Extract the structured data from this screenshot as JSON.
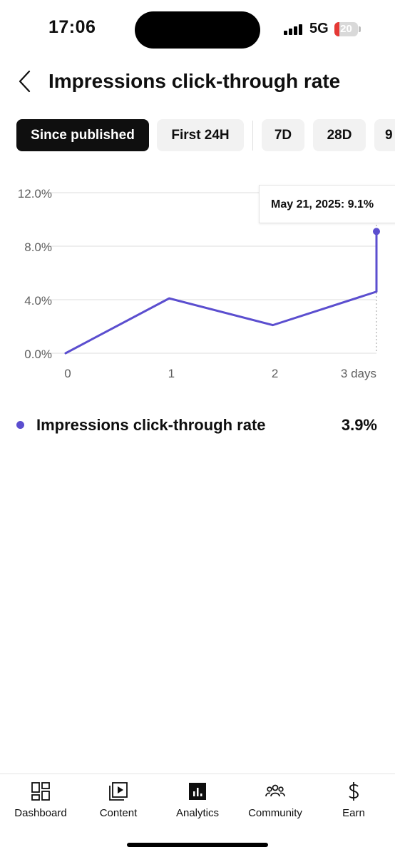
{
  "status_bar": {
    "time": "17:06",
    "network": "5G",
    "battery": "20",
    "battery_level": 0.2,
    "signal_bars": 4
  },
  "header": {
    "title": "Impressions click-through rate",
    "back_icon": "chevron-left-icon"
  },
  "filters": {
    "chips": [
      {
        "label": "Since published",
        "selected": true
      },
      {
        "label": "First 24H",
        "selected": false
      },
      {
        "label": "7D",
        "selected": false
      },
      {
        "label": "28D",
        "selected": false
      },
      {
        "label": "9",
        "selected": false
      }
    ]
  },
  "tooltip": {
    "text": "May 21, 2025: 9.1%"
  },
  "legend": {
    "label": "Impressions click-through rate",
    "value": "3.9%"
  },
  "colors": {
    "series": "#5b4ecf",
    "grid": "#dcdcdc",
    "axis_text": "#5f5f5f",
    "active_chip": "#0f0f0f",
    "chip": "#f2f2f2",
    "battery_low": "#e53935"
  },
  "chart_data": {
    "type": "line",
    "title": "",
    "xlabel": "",
    "ylabel": "",
    "x": [
      0,
      1,
      2,
      3,
      3
    ],
    "x_tick_labels": [
      "0",
      "1",
      "2",
      "3 days"
    ],
    "x_ticks": [
      0,
      1,
      2,
      3
    ],
    "y_tick_labels": [
      "12.0%",
      "8.0%",
      "4.0%",
      "0.0%"
    ],
    "y_ticks": [
      12,
      8,
      4,
      0
    ],
    "ylim": [
      0,
      12
    ],
    "xlim": [
      0,
      3
    ],
    "grid": true,
    "series": [
      {
        "values": [
          0,
          4.1,
          2.1,
          4.6,
          9.1
        ]
      }
    ],
    "highlight_point": {
      "x": 3,
      "y": 9.1,
      "label": "May 21, 2025: 9.1%"
    }
  },
  "bottom_nav": [
    {
      "label": "Dashboard",
      "icon": "dashboard-icon",
      "active": false
    },
    {
      "label": "Content",
      "icon": "content-icon",
      "active": false
    },
    {
      "label": "Analytics",
      "icon": "analytics-icon",
      "active": true
    },
    {
      "label": "Community",
      "icon": "community-icon",
      "active": false
    },
    {
      "label": "Earn",
      "icon": "earn-icon",
      "active": false
    }
  ]
}
